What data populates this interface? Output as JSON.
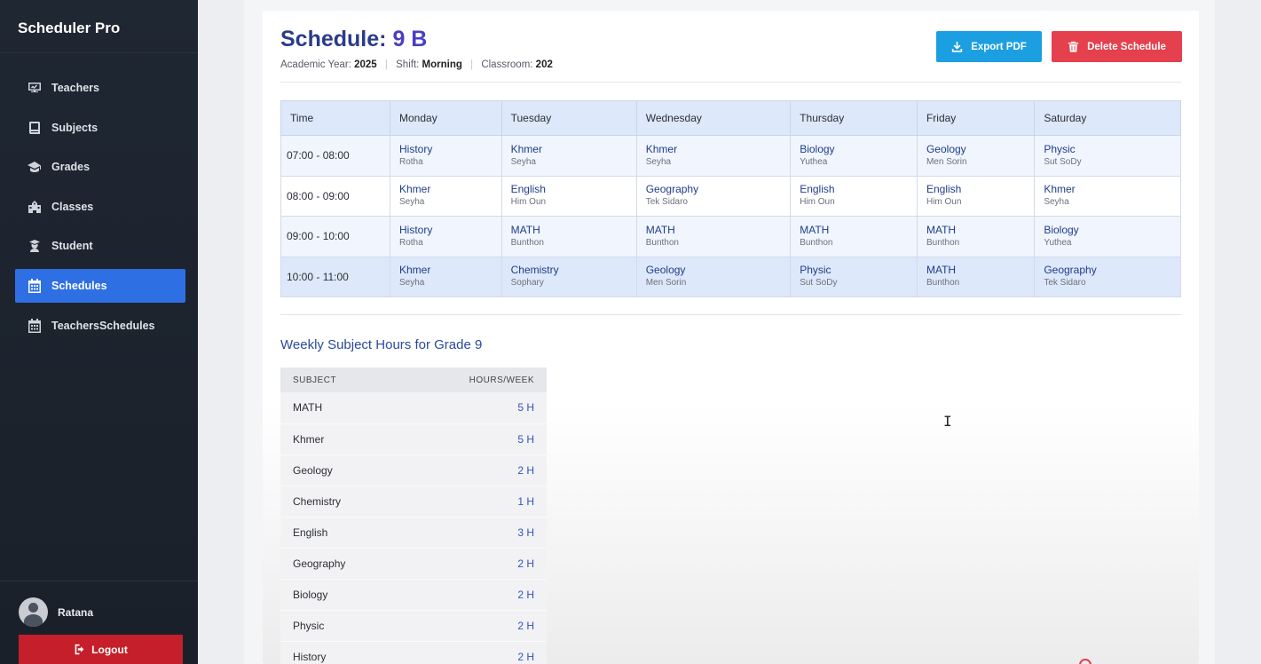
{
  "app": {
    "brand": "Scheduler Pro"
  },
  "sidebar": {
    "items": [
      {
        "label": "Teachers",
        "icon": "teacher-board-icon",
        "active": false
      },
      {
        "label": "Subjects",
        "icon": "book-icon",
        "active": false
      },
      {
        "label": "Grades",
        "icon": "graduation-cap-icon",
        "active": false
      },
      {
        "label": "Classes",
        "icon": "school-building-icon",
        "active": false
      },
      {
        "label": "Student",
        "icon": "student-icon",
        "active": false
      },
      {
        "label": "Schedules",
        "icon": "calendar-icon",
        "active": true
      },
      {
        "label": "TeachersSchedules",
        "icon": "calendar-icon",
        "active": false
      }
    ],
    "user": {
      "name": "Ratana"
    },
    "logout_label": "Logout"
  },
  "header": {
    "title_prefix": "Schedule:",
    "title_class": "9 B",
    "academic_year_label": "Academic Year:",
    "academic_year": "2025",
    "shift_label": "Shift:",
    "shift": "Morning",
    "classroom_label": "Classroom:",
    "classroom": "202",
    "export_label": "Export PDF",
    "delete_label": "Delete Schedule"
  },
  "schedule": {
    "headers": [
      "Time",
      "Monday",
      "Tuesday",
      "Wednesday",
      "Thursday",
      "Friday",
      "Saturday"
    ],
    "rows": [
      {
        "time": "07:00 - 08:00",
        "cells": [
          {
            "subject": "History",
            "teacher": "Rotha"
          },
          {
            "subject": "Khmer",
            "teacher": "Seyha"
          },
          {
            "subject": "Khmer",
            "teacher": "Seyha"
          },
          {
            "subject": "Biology",
            "teacher": "Yuthea"
          },
          {
            "subject": "Geology",
            "teacher": "Men Sorin"
          },
          {
            "subject": "Physic",
            "teacher": "Sut SoDy"
          }
        ]
      },
      {
        "time": "08:00 - 09:00",
        "cells": [
          {
            "subject": "Khmer",
            "teacher": "Seyha"
          },
          {
            "subject": "English",
            "teacher": "Him Oun"
          },
          {
            "subject": "Geography",
            "teacher": "Tek Sidaro"
          },
          {
            "subject": "English",
            "teacher": "Him Oun"
          },
          {
            "subject": "English",
            "teacher": "Him Oun"
          },
          {
            "subject": "Khmer",
            "teacher": "Seyha"
          }
        ]
      },
      {
        "time": "09:00 - 10:00",
        "cells": [
          {
            "subject": "History",
            "teacher": "Rotha"
          },
          {
            "subject": "MATH",
            "teacher": "Bunthon"
          },
          {
            "subject": "MATH",
            "teacher": "Bunthon"
          },
          {
            "subject": "MATH",
            "teacher": "Bunthon"
          },
          {
            "subject": "MATH",
            "teacher": "Bunthon"
          },
          {
            "subject": "Biology",
            "teacher": "Yuthea"
          }
        ]
      },
      {
        "time": "10:00 - 11:00",
        "cells": [
          {
            "subject": "Khmer",
            "teacher": "Seyha"
          },
          {
            "subject": "Chemistry",
            "teacher": "Sophary"
          },
          {
            "subject": "Geology",
            "teacher": "Men Sorin"
          },
          {
            "subject": "Physic",
            "teacher": "Sut SoDy"
          },
          {
            "subject": "MATH",
            "teacher": "Bunthon"
          },
          {
            "subject": "Geography",
            "teacher": "Tek Sidaro"
          }
        ]
      }
    ]
  },
  "hours": {
    "title": "Weekly Subject Hours for Grade 9",
    "col_subject": "SUBJECT",
    "col_hours": "HOURS/WEEK",
    "rows": [
      {
        "subject": "MATH",
        "hours": "5 H"
      },
      {
        "subject": "Khmer",
        "hours": "5 H"
      },
      {
        "subject": "Geology",
        "hours": "2 H"
      },
      {
        "subject": "Chemistry",
        "hours": "1 H"
      },
      {
        "subject": "English",
        "hours": "3 H"
      },
      {
        "subject": "Geography",
        "hours": "2 H"
      },
      {
        "subject": "Biology",
        "hours": "2 H"
      },
      {
        "subject": "Physic",
        "hours": "2 H"
      },
      {
        "subject": "History",
        "hours": "2 H"
      }
    ]
  },
  "colors": {
    "sidebar_bg": "#1f2733",
    "active_nav": "#2f6fe4",
    "export_button": "#1b9fe0",
    "delete_button": "#e5404d",
    "logout_button": "#c41f2a",
    "title": "#2a3c8a",
    "subject_text": "#1f3d8a"
  }
}
